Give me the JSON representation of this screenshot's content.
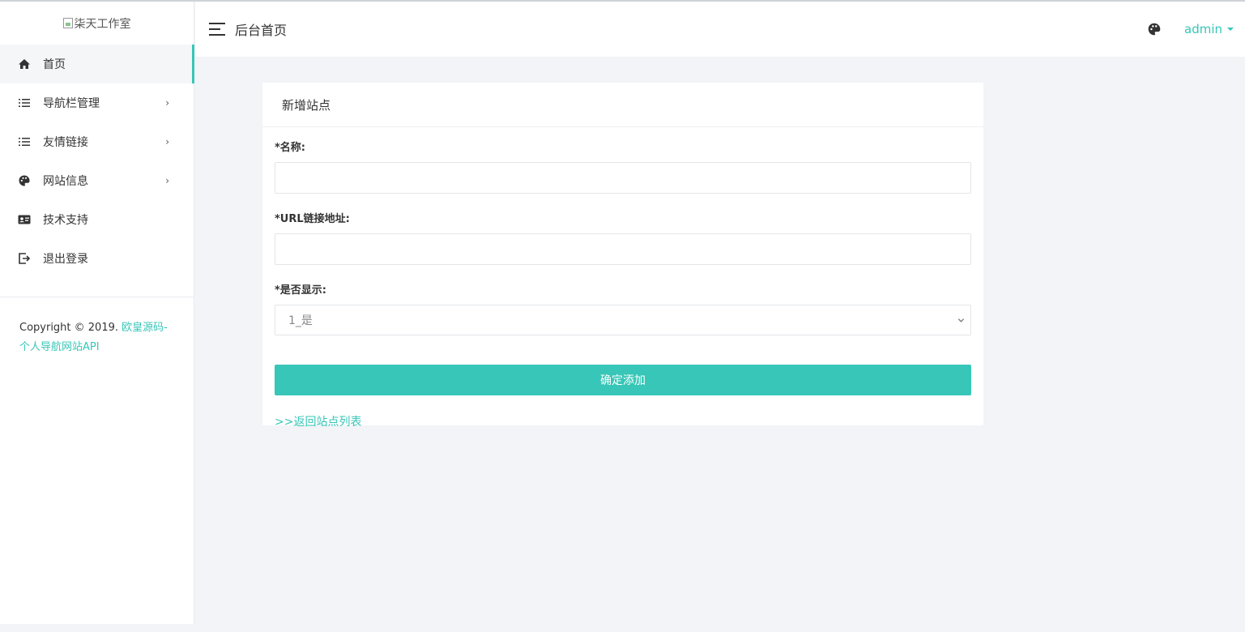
{
  "brand": {
    "logo_alt": "柒天工作室",
    "accent_color": "#37c6b7"
  },
  "sidebar": {
    "items": [
      {
        "label": "首页",
        "icon": "home-icon",
        "active": true
      },
      {
        "label": "导航栏管理",
        "icon": "list-icon",
        "has_submenu": true
      },
      {
        "label": "友情链接",
        "icon": "list-icon",
        "has_submenu": true
      },
      {
        "label": "网站信息",
        "icon": "palette-icon",
        "has_submenu": true
      },
      {
        "label": "技术支持",
        "icon": "id-card-icon"
      },
      {
        "label": "退出登录",
        "icon": "logout-icon"
      }
    ],
    "copyright_prefix": "Copyright © 2019. ",
    "copyright_link": "欧皇源码-个人导航网站API"
  },
  "header": {
    "title": "后台首页",
    "user": "admin"
  },
  "form": {
    "title": "新增站点",
    "name_label": "*名称:",
    "name_value": "",
    "url_label": "*URL链接地址:",
    "url_value": "",
    "display_label": "*是否显示:",
    "display_selected": "1_是",
    "submit_label": "确定添加",
    "back_link": ">>返回站点列表"
  }
}
